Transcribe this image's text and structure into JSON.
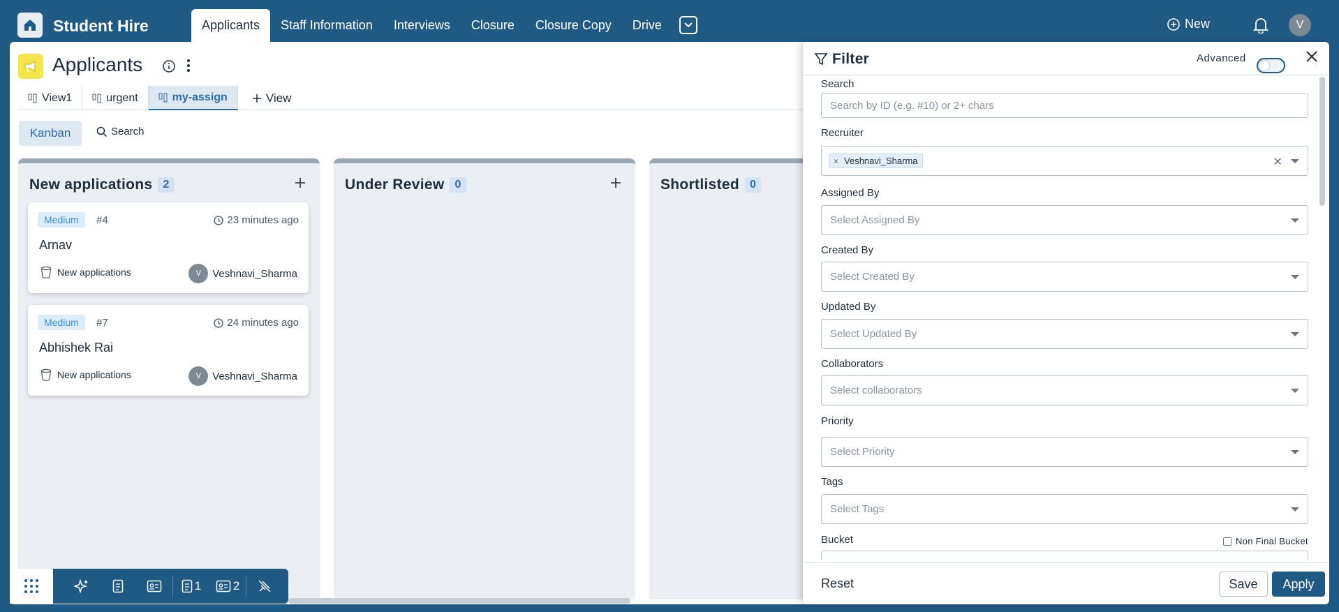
{
  "app": {
    "title": "Student Hire",
    "nav": [
      "Applicants",
      "Staff Information",
      "Interviews",
      "Closure",
      "Closure Copy",
      "Drive"
    ],
    "active_nav": "Applicants",
    "new_label": "New",
    "user_initial": "V"
  },
  "page": {
    "title": "Applicants",
    "views": [
      "View1",
      "urgent",
      "my-assign"
    ],
    "active_view": "my-assign",
    "add_view_label": "View",
    "kanban_label": "Kanban",
    "search_label": "Search"
  },
  "columns": [
    {
      "title": "New applications",
      "count": "2",
      "cards": [
        {
          "priority": "Medium",
          "id": "#4",
          "time": "23 minutes ago",
          "name": "Arnav",
          "bucket": "New applications",
          "user": "Veshnavi_Sharma",
          "user_initial": "V"
        },
        {
          "priority": "Medium",
          "id": "#7",
          "time": "24 minutes ago",
          "name": "Abhishek Rai",
          "bucket": "New applications",
          "user": "Veshnavi_Sharma",
          "user_initial": "V"
        }
      ]
    },
    {
      "title": "Under Review",
      "count": "0",
      "cards": []
    },
    {
      "title": "Shortlisted",
      "count": "0",
      "cards": []
    }
  ],
  "toolbar": {
    "doc_count": "1",
    "card_count": "2"
  },
  "filter": {
    "title": "Filter",
    "advanced_label": "Advanced",
    "advanced_on": false,
    "search_label": "Search",
    "search_placeholder": "Search by ID (e.g. #10) or 2+ chars",
    "recruiter_label": "Recruiter",
    "recruiter_value": "Veshnavi_Sharma",
    "assigned_by_label": "Assigned By",
    "assigned_by_placeholder": "Select Assigned By",
    "created_by_label": "Created By",
    "created_by_placeholder": "Select Created By",
    "updated_by_label": "Updated By",
    "updated_by_placeholder": "Select Updated By",
    "collaborators_label": "Collaborators",
    "collaborators_placeholder": "Select collaborators",
    "priority_label": "Priority",
    "priority_placeholder": "Select Priority",
    "tags_label": "Tags",
    "tags_placeholder": "Select Tags",
    "bucket_label": "Bucket",
    "non_final_bucket_label": "Non Final Bucket",
    "reset_label": "Reset",
    "save_label": "Save",
    "apply_label": "Apply"
  }
}
